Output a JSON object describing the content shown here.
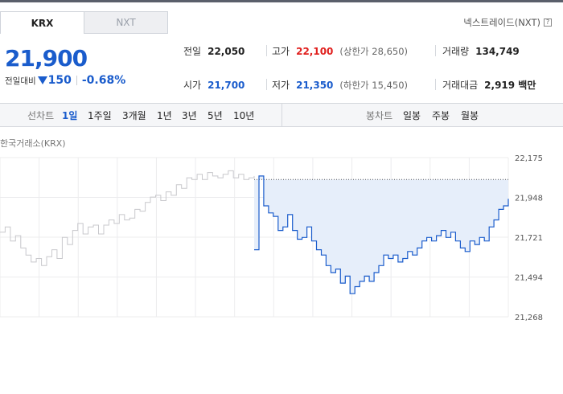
{
  "tabs": {
    "krx": "KRX",
    "nxt": "NXT"
  },
  "nxt_link": "넥스트레이드(NXT)",
  "price": "21,900",
  "change": {
    "label": "전일대비",
    "amount": "150",
    "percent": "-0.68%"
  },
  "stats": {
    "prev_close": {
      "label": "전일",
      "value": "22,050"
    },
    "high": {
      "label": "고가",
      "value": "22,100",
      "sub": "(상한가 28,650)"
    },
    "volume": {
      "label": "거래량",
      "value": "134,749"
    },
    "open": {
      "label": "시가",
      "value": "21,700"
    },
    "low": {
      "label": "저가",
      "value": "21,350",
      "sub": "(하한가 15,450)"
    },
    "amount": {
      "label": "거래대금",
      "value": "2,919 백만"
    }
  },
  "period_bar": {
    "line_label": "선차트",
    "line_items": [
      "1일",
      "1주일",
      "3개월",
      "1년",
      "3년",
      "5년",
      "10년"
    ],
    "active": "1일",
    "candle_label": "봉차트",
    "candle_items": [
      "일봉",
      "주봉",
      "월봉"
    ]
  },
  "exchange_label": "한국거래소(KRX)",
  "colors": {
    "blue": "#1a5ccc",
    "red": "#e0201e",
    "fill": "#e6eefa",
    "prev": "#c8c8cc"
  },
  "chart_data": {
    "type": "line",
    "ylim": [
      21268,
      22175
    ],
    "yticks": [
      "22,175",
      "21,948",
      "21,721",
      "21,494",
      "21,268"
    ],
    "reference_close": 22050,
    "prev_day": [
      21750,
      21780,
      21700,
      21730,
      21660,
      21620,
      21580,
      21600,
      21560,
      21610,
      21650,
      21600,
      21720,
      21680,
      21760,
      21800,
      21740,
      21780,
      21790,
      21740,
      21790,
      21820,
      21800,
      21850,
      21820,
      21830,
      21880,
      21870,
      21920,
      21950,
      21960,
      21930,
      21980,
      21960,
      22020,
      22000,
      22060,
      22050,
      22080,
      22050,
      22090,
      22070,
      22060,
      22080,
      22100,
      22060,
      22080,
      22050,
      22060,
      22070
    ],
    "today": [
      21650,
      22070,
      21900,
      21860,
      21840,
      21760,
      21780,
      21850,
      21760,
      21710,
      21720,
      21780,
      21700,
      21650,
      21620,
      21560,
      21520,
      21540,
      21460,
      21500,
      21400,
      21440,
      21470,
      21500,
      21470,
      21520,
      21560,
      21620,
      21600,
      21620,
      21580,
      21600,
      21640,
      21620,
      21660,
      21700,
      21720,
      21700,
      21730,
      21760,
      21720,
      21750,
      21700,
      21660,
      21640,
      21700,
      21680,
      21720,
      21700,
      21780,
      21820,
      21880,
      21900,
      21940
    ]
  }
}
